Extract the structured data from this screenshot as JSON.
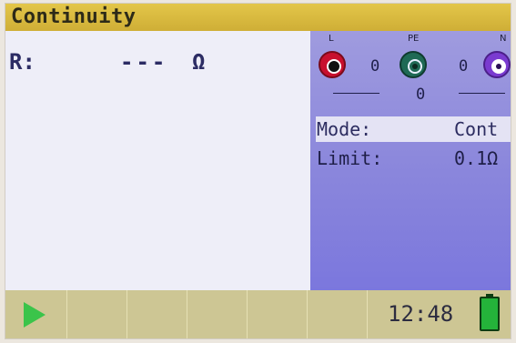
{
  "title": "Continuity",
  "result": {
    "label": "R:",
    "value": "---",
    "unit": "Ω"
  },
  "terminals": {
    "l": {
      "label": "L",
      "value": "0",
      "color": "#c8102e"
    },
    "pe": {
      "label": "PE",
      "value": "0",
      "color": "#1f6a55"
    },
    "n": {
      "label": "N",
      "color": "#7a3bd0"
    },
    "pe_n_value": "0",
    "l_pe_n_value": "0"
  },
  "settings": {
    "mode_label": "Mode:",
    "mode_value": "Cont",
    "limit_label": "Limit:",
    "limit_value": "0.1Ω"
  },
  "status": {
    "time": "12:48",
    "battery_color": "#24b33a",
    "start_icon": "play-icon"
  },
  "colors": {
    "title_bar": "#d6b83d",
    "info_panel": "#8a86dc",
    "bottom_bar": "#cdc694",
    "start": "#3bc44a"
  }
}
